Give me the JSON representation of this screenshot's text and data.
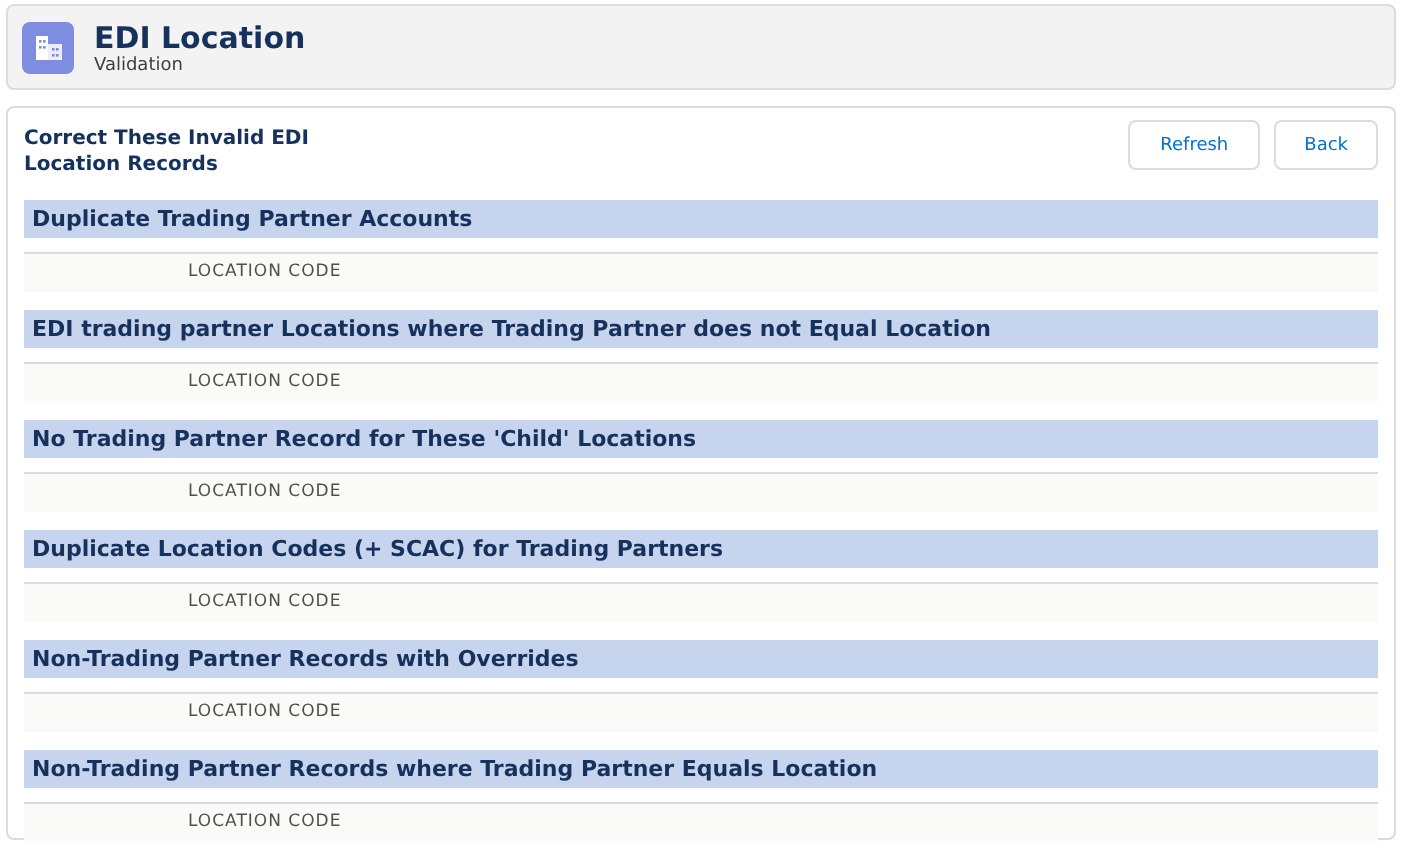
{
  "header": {
    "title": "EDI Location",
    "subtitle": "Validation"
  },
  "card": {
    "title": "Correct These Invalid EDI Location Records",
    "buttons": [
      "Refresh",
      "Back"
    ]
  },
  "sections": [
    {
      "title": "Duplicate Trading Partner Accounts",
      "columns": [
        "LOCATION CODE"
      ]
    },
    {
      "title": "EDI trading partner Locations where Trading Partner does not Equal Location",
      "columns": [
        "LOCATION CODE"
      ]
    },
    {
      "title": "No Trading Partner Record for These 'Child' Locations",
      "columns": [
        "LOCATION CODE"
      ]
    },
    {
      "title": "Duplicate Location Codes (+ SCAC) for Trading Partners",
      "columns": [
        "LOCATION CODE"
      ]
    },
    {
      "title": "Non-Trading Partner Records with Overrides",
      "columns": [
        "LOCATION CODE"
      ]
    },
    {
      "title": "Non-Trading Partner Records where Trading Partner Equals Location",
      "columns": [
        "LOCATION CODE"
      ]
    }
  ]
}
